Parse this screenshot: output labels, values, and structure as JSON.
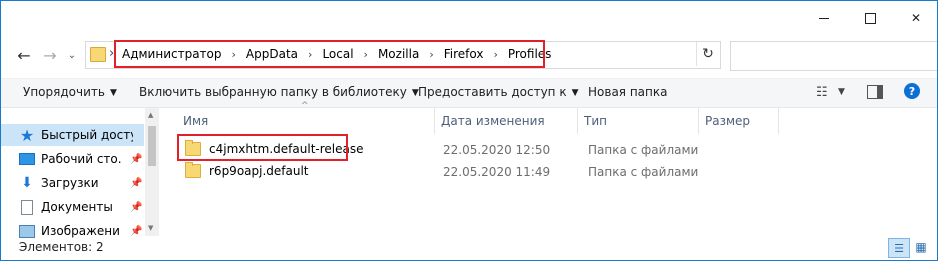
{
  "window": {
    "controls": {
      "minimize_icon": "minimize-icon",
      "maximize_icon": "maximize-icon",
      "close_glyph": "✕"
    }
  },
  "address_bar": {
    "crumbs": [
      "Администратор",
      "AppData",
      "Local",
      "Mozilla",
      "Firefox",
      "Profiles"
    ],
    "highlight_color": "#e2202b"
  },
  "search": {
    "placeholder": ""
  },
  "toolbar": {
    "organize": "Упорядочить",
    "include_library": "Включить выбранную папку в библиотеку",
    "share": "Предоставить доступ к",
    "new_folder": "Новая папка"
  },
  "nav_pane": {
    "items": [
      {
        "label": "Быстрый доступ",
        "icon": "star-icon"
      },
      {
        "label": "Рабочий сто.",
        "icon": "desktop-icon"
      },
      {
        "label": "Загрузки",
        "icon": "download-icon"
      },
      {
        "label": "Документы",
        "icon": "documents-icon"
      },
      {
        "label": "Изображени",
        "icon": "pictures-icon"
      }
    ]
  },
  "columns": {
    "name": "Имя",
    "date": "Дата изменения",
    "type": "Тип",
    "size": "Размер"
  },
  "files": [
    {
      "name": "c4jmxhtm.default-release",
      "date": "22.05.2020 12:50",
      "type": "Папка с файлами"
    },
    {
      "name": "r6p9oapj.default",
      "date": "22.05.2020 11:49",
      "type": "Папка с файлами"
    }
  ],
  "status": {
    "count_text": "Элементов: 2"
  },
  "colors": {
    "accent": "#0c6fd6",
    "selection": "#cce4f7",
    "folder": "#f8d775"
  }
}
